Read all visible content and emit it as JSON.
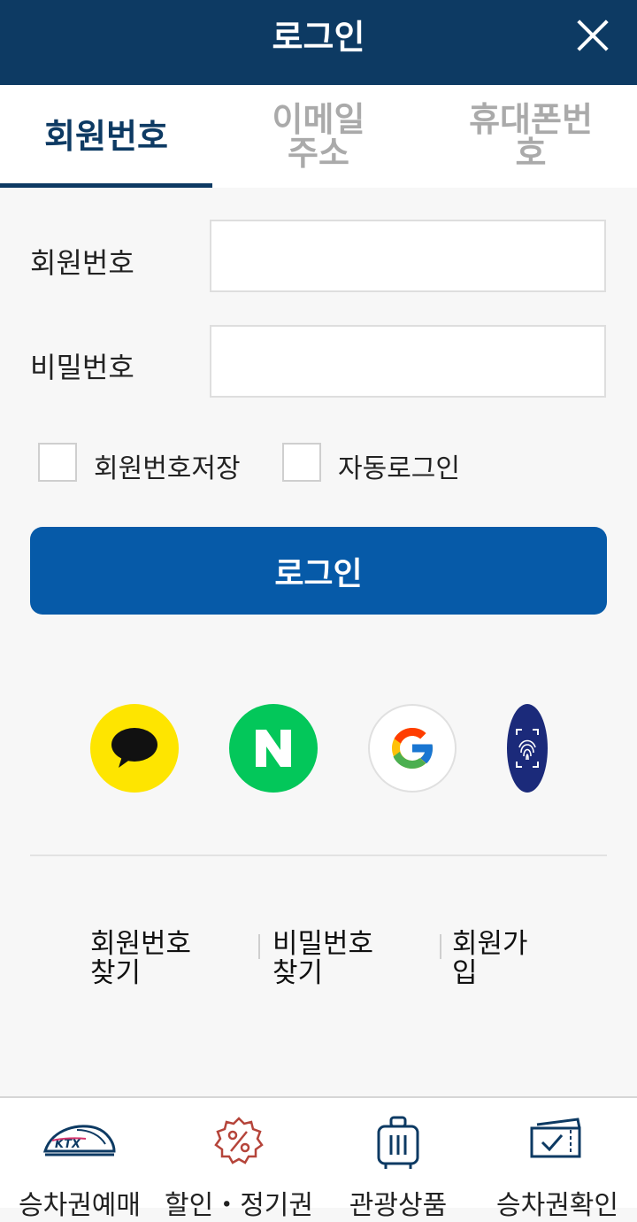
{
  "header": {
    "title": "로그인"
  },
  "tabs": [
    {
      "label": "회원번호",
      "active": true
    },
    {
      "label": "이메일 주소",
      "active": false
    },
    {
      "label": "휴대폰번호",
      "active": false
    }
  ],
  "form": {
    "member_label": "회원번호",
    "member_value": "",
    "password_label": "비밀번호",
    "password_value": "",
    "save_member_label": "회원번호저장",
    "auto_login_label": "자동로그인",
    "login_button": "로그인"
  },
  "social": [
    "kakao-icon",
    "naver-icon",
    "google-icon",
    "fingerprint-icon"
  ],
  "links": {
    "find_member": "회원번호 찾기",
    "find_password": "비밀번호 찾기",
    "signup": "회원가입"
  },
  "bottom_nav": {
    "ticket": "승차권예매",
    "discount": "할인・정기권",
    "tour": "관광상품",
    "check": "승차권확인"
  },
  "colors": {
    "header": "#0d3a63",
    "primary_button": "#065aa8",
    "kakao": "#fee500",
    "naver": "#03c75a"
  }
}
